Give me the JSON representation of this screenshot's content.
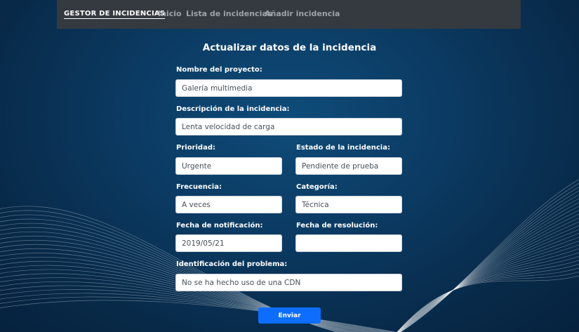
{
  "navbar": {
    "brand": "GESTOR DE INCIDENCIAS",
    "links": [
      "Inicio",
      "Lista de incidencias",
      "Añadir incidencia"
    ]
  },
  "form": {
    "title": "Actualizar datos de la incidencia",
    "fields": {
      "project_name": {
        "label": "Nombre del proyecto:",
        "value": "Galería multimedia"
      },
      "description": {
        "label": "Descripción de la incidencia:",
        "value": "Lenta velocidad de carga"
      },
      "priority": {
        "label": "Prioridad:",
        "value": "Urgente"
      },
      "status": {
        "label": "Estado de la incidencia:",
        "value": "Pendiente de prueba"
      },
      "frequency": {
        "label": "Frecuencia:",
        "value": "A veces"
      },
      "category": {
        "label": "Categoría:",
        "value": "Técnica"
      },
      "notification_date": {
        "label": "Fecha de notificación:",
        "value": "2019/05/21"
      },
      "resolution_date": {
        "label": "Fecha de resolución:",
        "value": ""
      },
      "problem_id": {
        "label": "Identificación del problema:",
        "value": "No se ha hecho uso de una CDN"
      }
    },
    "submit_label": "Enviar"
  },
  "colors": {
    "background": "#0b3a62",
    "navbar": "#343a40",
    "button": "#0d6efd"
  }
}
